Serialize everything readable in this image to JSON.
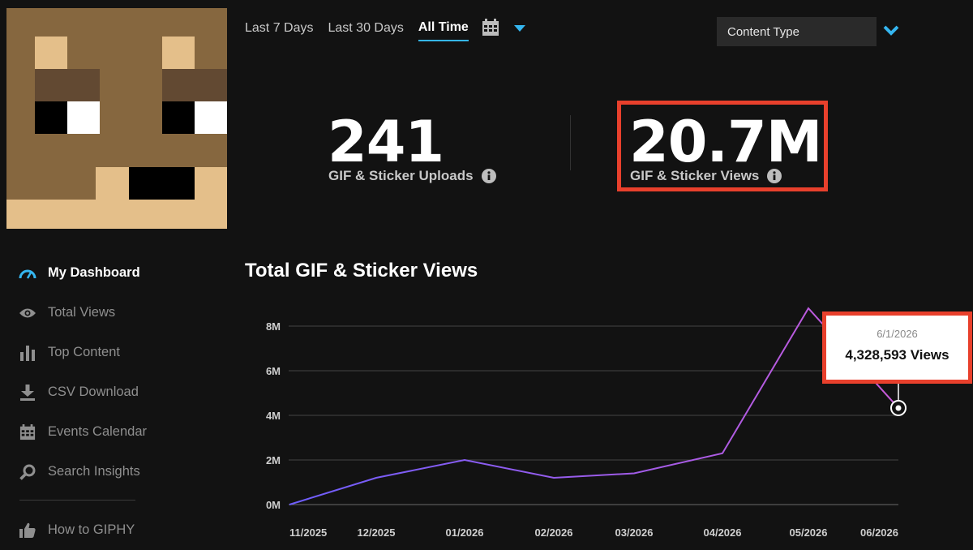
{
  "time_tabs": [
    "Last 7 Days",
    "Last 30 Days",
    "All Time"
  ],
  "active_tab": "All Time",
  "content_type": {
    "label": "Content Type"
  },
  "stats": [
    {
      "value": "241",
      "label": "GIF & Sticker Uploads"
    },
    {
      "value": "20.7M",
      "label": "GIF & Sticker Views"
    }
  ],
  "sidebar": {
    "items": [
      {
        "label": "My Dashboard",
        "icon": "gauge-icon",
        "active": true
      },
      {
        "label": "Total Views",
        "icon": "eye-icon"
      },
      {
        "label": "Top Content",
        "icon": "bar-chart-icon"
      },
      {
        "label": "CSV Download",
        "icon": "download-icon"
      },
      {
        "label": "Events Calendar",
        "icon": "calendar-icon"
      },
      {
        "label": "Search Insights",
        "icon": "search-icon"
      }
    ],
    "footer": {
      "label": "How to GIPHY",
      "icon": "thumbs-up-icon"
    }
  },
  "chart_data": {
    "type": "line",
    "title": "Total GIF & Sticker Views",
    "x": [
      "11/2025",
      "12/2025",
      "01/2026",
      "02/2026",
      "03/2026",
      "04/2026",
      "05/2026",
      "06/2026"
    ],
    "series": [
      {
        "values": [
          0,
          1200000,
          2000000,
          1200000,
          1400000,
          2300000,
          8800000,
          4328593
        ]
      }
    ],
    "y_ticks": [
      "0M",
      "2M",
      "4M",
      "6M",
      "8M"
    ],
    "ylim": [
      0,
      8000000
    ],
    "grid": true,
    "line_color_start": "#6d5dfc",
    "line_color_end": "#c85ad8",
    "tooltip": {
      "date": "6/1/2026",
      "value": "4,328,593 Views"
    }
  },
  "colors": {
    "accent": "#35b6f0",
    "highlight": "#e8402c",
    "background": "#121212"
  }
}
